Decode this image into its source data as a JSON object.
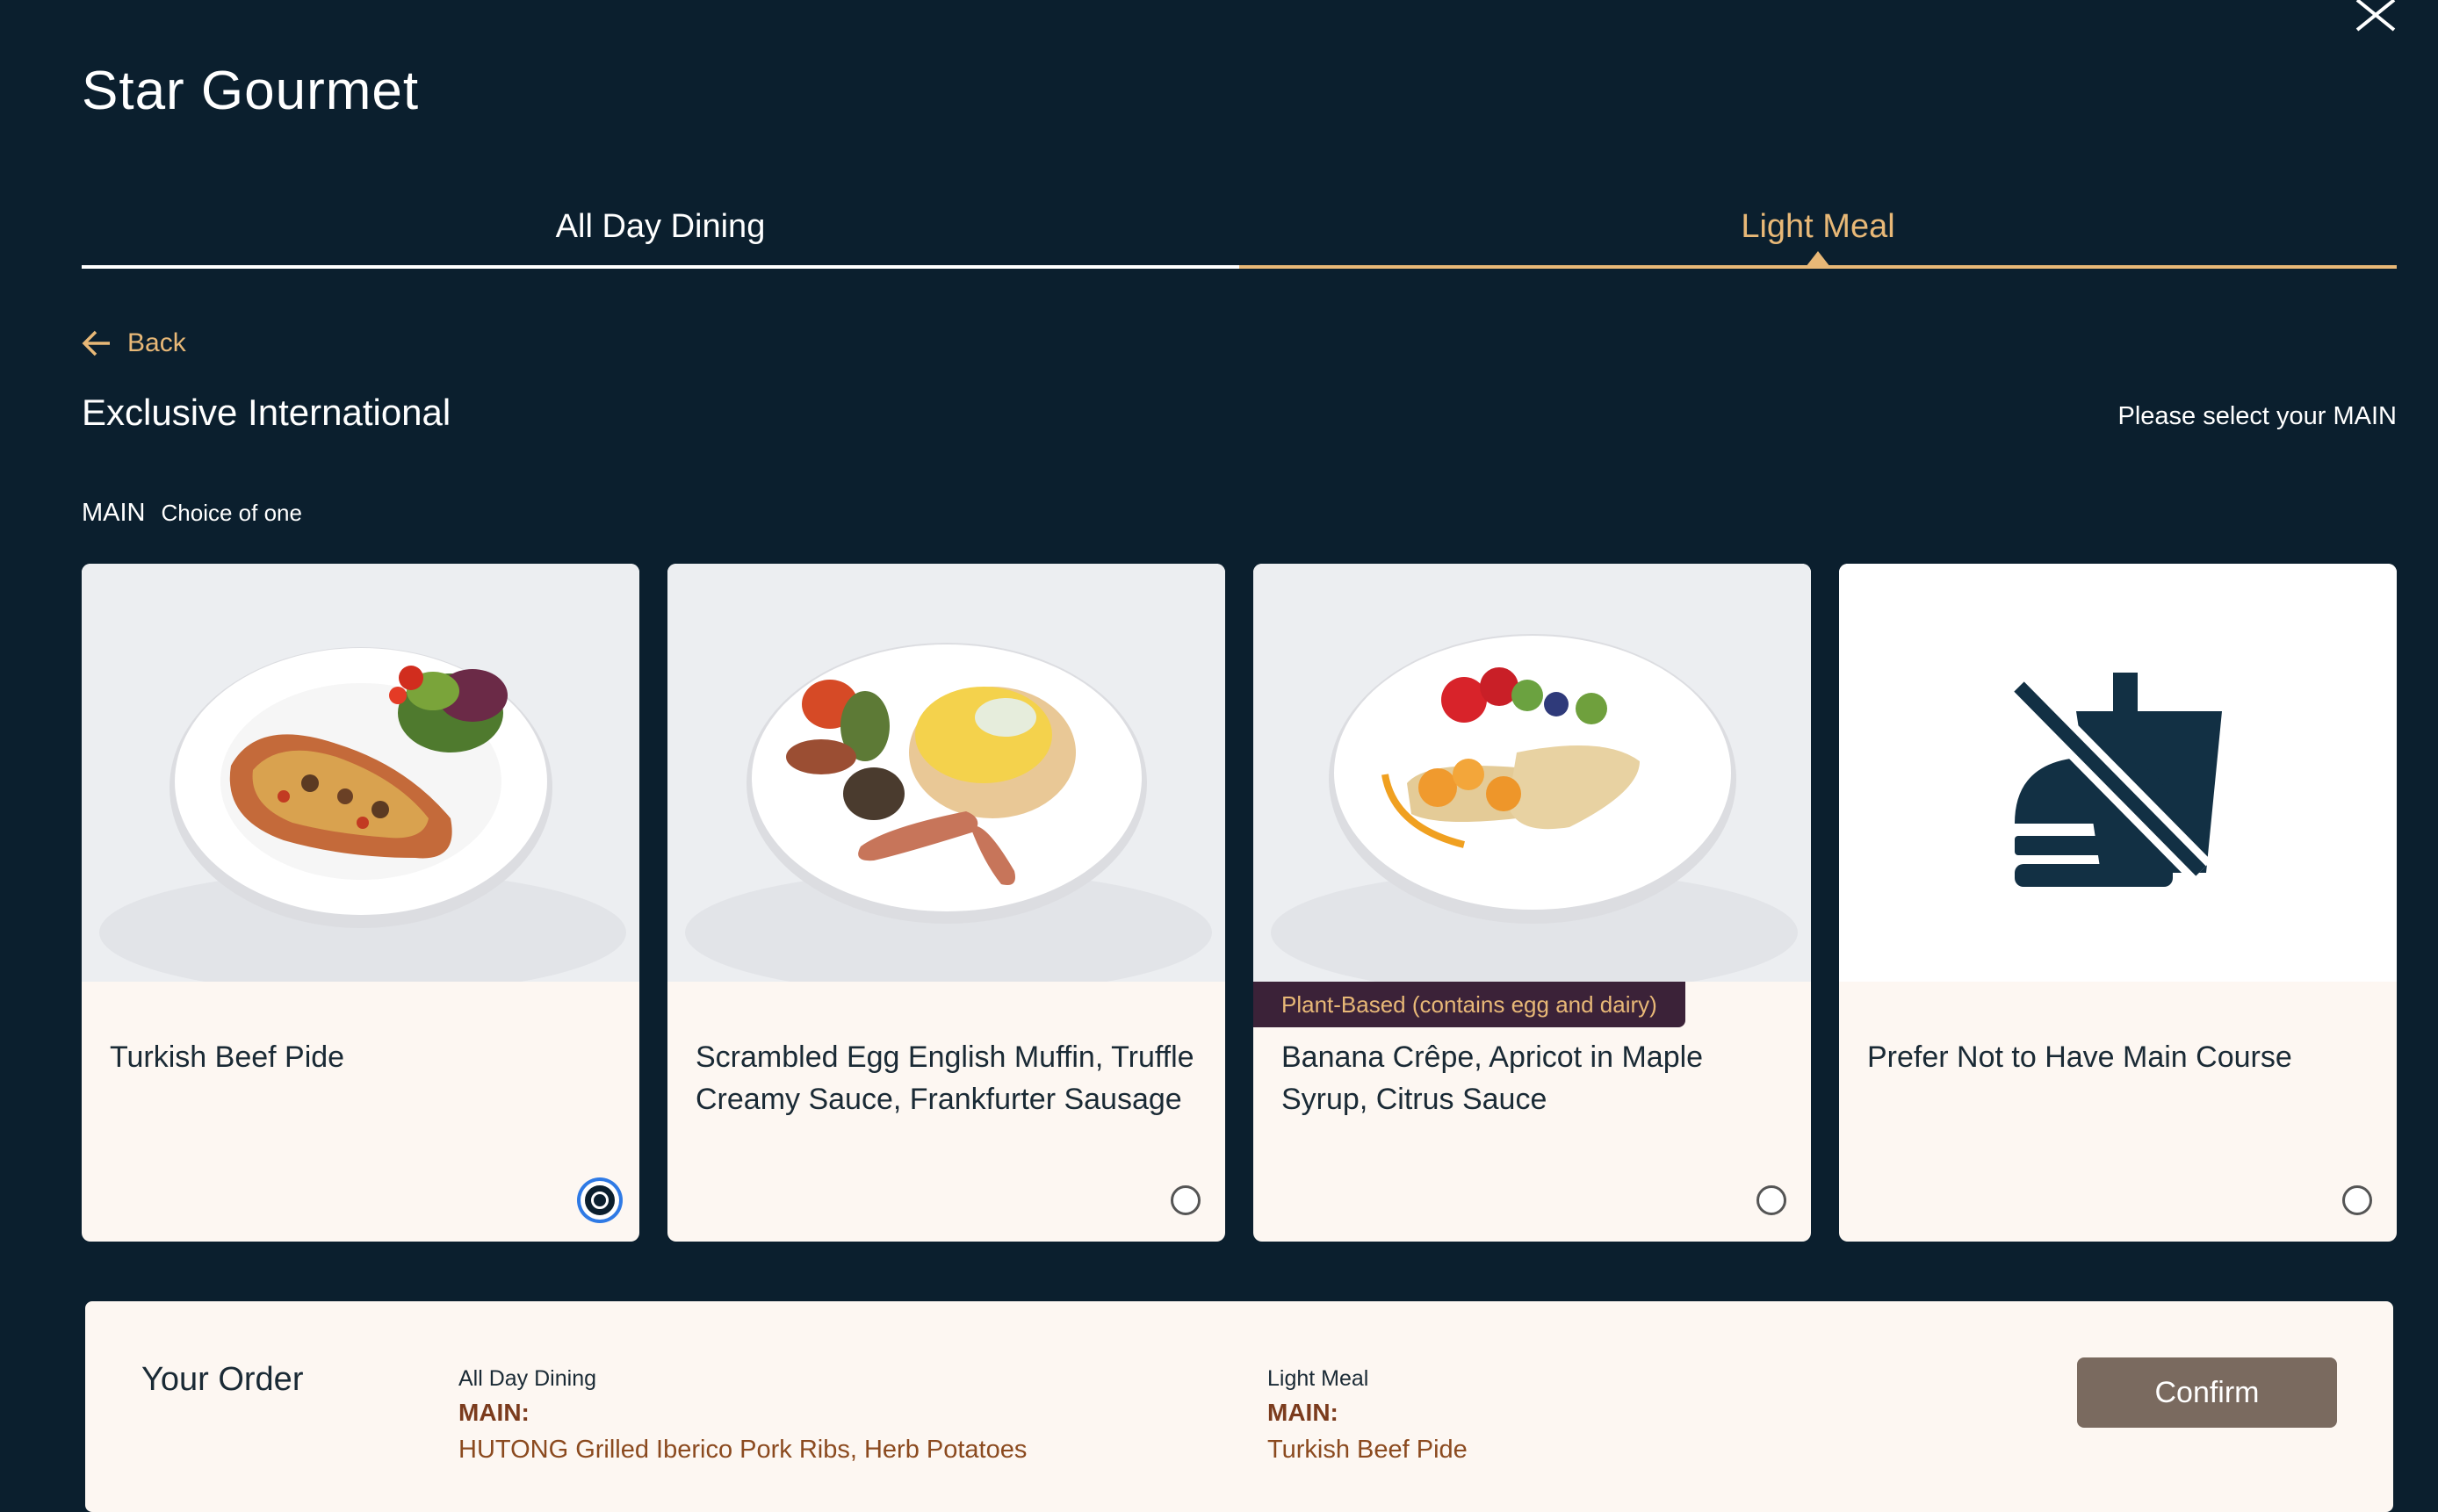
{
  "app": {
    "title": "Star Gourmet"
  },
  "tabs": [
    {
      "label": "All Day Dining",
      "active": false
    },
    {
      "label": "Light Meal",
      "active": true
    }
  ],
  "nav": {
    "back_label": "Back"
  },
  "section": {
    "title": "Exclusive International",
    "prompt": "Please select your MAIN"
  },
  "course": {
    "label": "MAIN",
    "hint": "Choice of one"
  },
  "options": [
    {
      "name": "Turkish Beef Pide",
      "tag": "",
      "selected": true,
      "image": "turkish-beef-pide-photo"
    },
    {
      "name": "Scrambled Egg English Muffin, Truffle Creamy Sauce, Frankfurter Sausage",
      "tag": "",
      "selected": false,
      "image": "scrambled-egg-muffin-photo"
    },
    {
      "name": "Banana Crêpe, Apricot in Maple Syrup, Citrus Sauce",
      "tag": "Plant-Based (contains egg and dairy)",
      "selected": false,
      "image": "banana-crepe-photo"
    },
    {
      "name": "Prefer Not to Have Main Course",
      "tag": "",
      "selected": false,
      "image": "no-meal-icon"
    }
  ],
  "order": {
    "heading": "Your Order",
    "items": [
      {
        "category": "All Day Dining",
        "course": "MAIN:",
        "dish": "HUTONG Grilled Iberico Pork Ribs, Herb Potatoes"
      },
      {
        "category": "Light Meal",
        "course": "MAIN:",
        "dish": "Turkish Beef Pide"
      }
    ],
    "confirm_label": "Confirm"
  },
  "colors": {
    "background": "#0b1f2e",
    "accent": "#e8b877",
    "card": "#fdf7f2",
    "tag_bg": "#3b2238",
    "order_text": "#8b4a1f",
    "confirm_bg": "#7a6a5f"
  }
}
